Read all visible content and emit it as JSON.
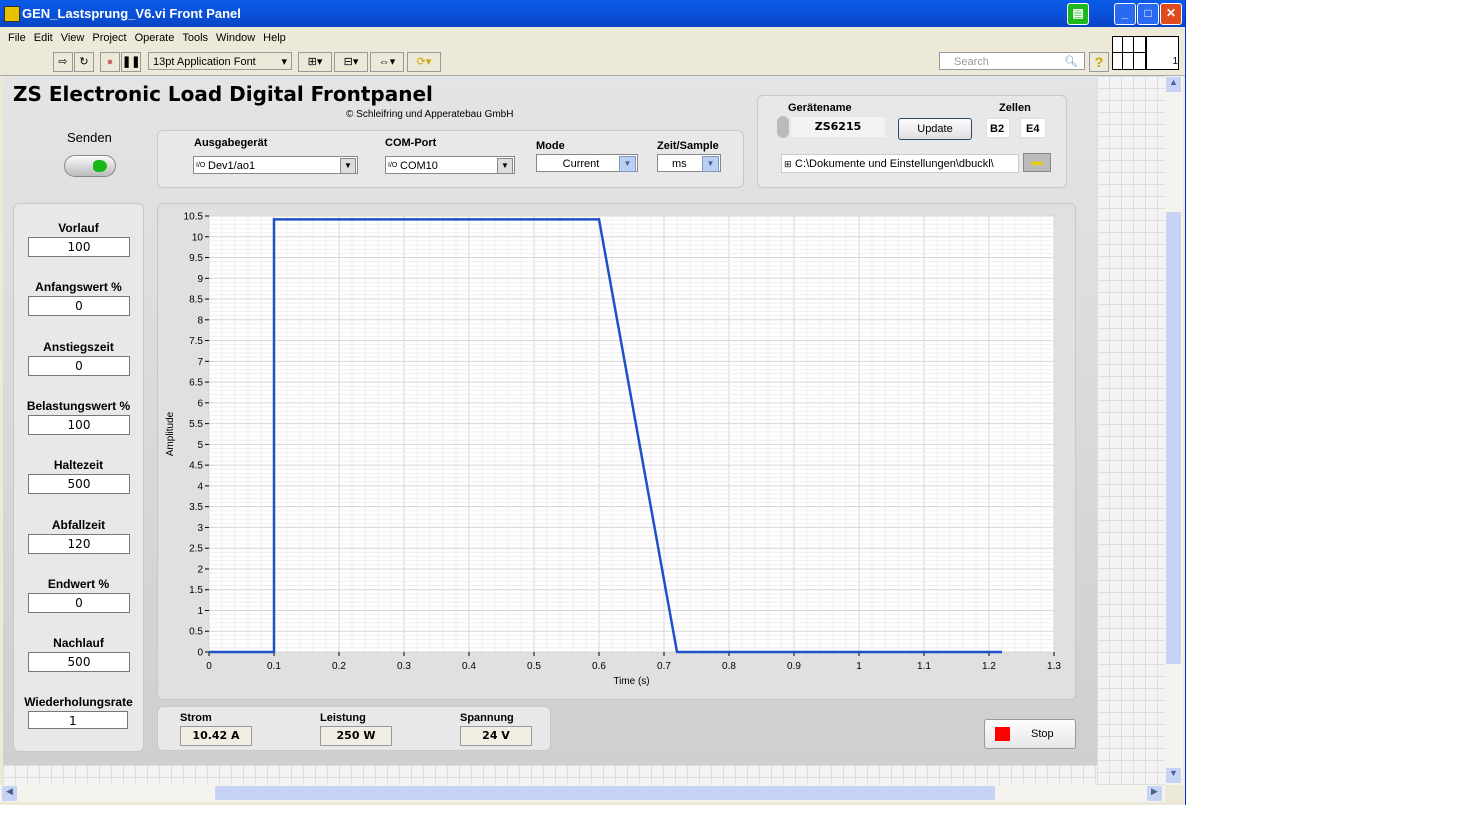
{
  "window": {
    "title": "GEN_Lastsprung_V6.vi Front Panel"
  },
  "menu": [
    "File",
    "Edit",
    "View",
    "Project",
    "Operate",
    "Tools",
    "Window",
    "Help"
  ],
  "toolbar": {
    "font": "13pt Application Font",
    "search_placeholder": "Search",
    "help": "?",
    "vi_icon_num": "1"
  },
  "header": {
    "title": "ZS Electronic Load Digital Frontpanel",
    "copyright": "© Schleifring und Apperatebau GmbH"
  },
  "senden": {
    "label": "Senden"
  },
  "io": {
    "ausgabe_label": "Ausgabegerät",
    "ausgabe_value": "Dev1/ao1",
    "com_label": "COM-Port",
    "com_value": "COM10",
    "mode_label": "Mode",
    "mode_value": "Current",
    "zeit_label": "Zeit/Sample",
    "zeit_value": "ms"
  },
  "device": {
    "name_label": "Gerätename",
    "name_value": "ZS6215",
    "update": "Update",
    "zellen_label": "Zellen",
    "zelle1": "B2",
    "zelle2": "E4",
    "path": "C:\\Dokumente und Einstellungen\\dbuckl\\"
  },
  "params": [
    {
      "label": "Vorlauf",
      "value": "100"
    },
    {
      "label": "Anfangswert %",
      "value": "0"
    },
    {
      "label": "Anstiegszeit",
      "value": "0"
    },
    {
      "label": "Belastungswert %",
      "value": "100"
    },
    {
      "label": "Haltezeit",
      "value": "500"
    },
    {
      "label": "Abfallzeit",
      "value": "120"
    },
    {
      "label": "Endwert %",
      "value": "0"
    },
    {
      "label": "Nachlauf",
      "value": "500"
    },
    {
      "label": "Wiederholungsrate",
      "value": "1"
    }
  ],
  "readouts": {
    "strom_label": "Strom",
    "strom": "10.42 A",
    "leistung_label": "Leistung",
    "leistung": "250 W",
    "spannung_label": "Spannung",
    "spannung": "24 V"
  },
  "stop": {
    "label": "Stop"
  },
  "chart_data": {
    "type": "line",
    "xlabel": "Time (s)",
    "ylabel": "Amplitude",
    "xlim": [
      0,
      1.3
    ],
    "ylim": [
      0,
      10.5
    ],
    "xticks": [
      "0",
      "0.1",
      "0.2",
      "0.3",
      "0.4",
      "0.5",
      "0.6",
      "0.7",
      "0.8",
      "0.9",
      "1",
      "1.1",
      "1.2",
      "1.3"
    ],
    "yticks": [
      "0",
      "0.5",
      "1",
      "1.5",
      "2",
      "2.5",
      "3",
      "3.5",
      "4",
      "4.5",
      "5",
      "5.5",
      "6",
      "6.5",
      "7",
      "7.5",
      "8",
      "8.5",
      "9",
      "9.5",
      "10",
      "10.5"
    ],
    "grid": true,
    "series": [
      {
        "name": "Amplitude",
        "color": "#1e50c8",
        "x": [
          0,
          0.1,
          0.1,
          0.6,
          0.72,
          1.22
        ],
        "y": [
          0,
          0,
          10.42,
          10.42,
          0,
          0
        ]
      }
    ]
  }
}
